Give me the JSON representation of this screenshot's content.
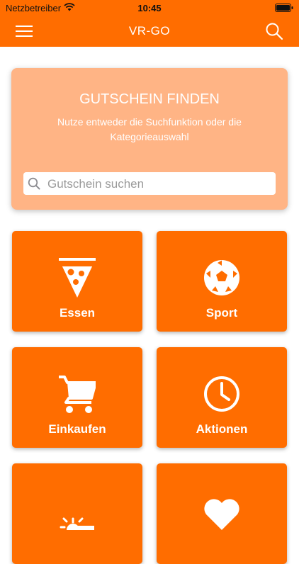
{
  "status_bar": {
    "carrier": "Netzbetreiber",
    "time": "10:45"
  },
  "nav": {
    "title": "VR-GO"
  },
  "hero": {
    "title": "GUTSCHEIN FINDEN",
    "subtitle": "Nutze entweder die Suchfunktion oder die Kategorieauswahl",
    "search_placeholder": "Gutschein suchen",
    "search_value": ""
  },
  "categories": [
    {
      "label": "Essen",
      "icon": "pizza-icon"
    },
    {
      "label": "Sport",
      "icon": "soccer-ball-icon"
    },
    {
      "label": "Einkaufen",
      "icon": "shopping-cart-icon"
    },
    {
      "label": "Aktionen",
      "icon": "clock-icon"
    },
    {
      "label": "",
      "icon": "weather-icon"
    },
    {
      "label": "",
      "icon": "heart-icon"
    }
  ],
  "colors": {
    "primary": "#ff6d00",
    "hero_bg": "#ffb485",
    "text_light": "#ffffff"
  }
}
